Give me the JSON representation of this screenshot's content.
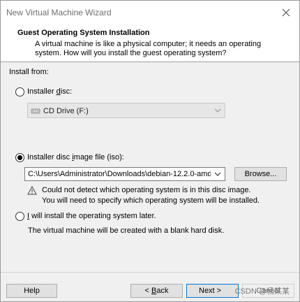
{
  "window": {
    "title": "New Virtual Machine Wizard"
  },
  "header": {
    "title": "Guest Operating System Installation",
    "description": "A virtual machine is like a physical computer; it needs an operating system. How will you install the guest operating system?"
  },
  "install_from": {
    "label": "Install from:",
    "options": [
      {
        "pre": "Installer ",
        "accel": "d",
        "post": "isc:",
        "selected": false
      },
      {
        "pre": "Installer disc ",
        "accel": "i",
        "post": "mage file (iso):",
        "selected": true
      },
      {
        "pre": "",
        "accel": "I",
        "post": " will install the operating system later.",
        "selected": false
      }
    ]
  },
  "drive_select": {
    "value": "CD Drive (F:)",
    "enabled": false
  },
  "iso_select": {
    "value": "C:\\Users\\Administrator\\Downloads\\debian-12.2.0-amd"
  },
  "browse_button": {
    "label": "Browse..."
  },
  "warning": {
    "line1": "Could not detect which operating system is in this disc image.",
    "line2": "You will need to specify which operating system will be installed."
  },
  "later_desc": "The virtual machine will be created with a blank hard disk.",
  "footer": {
    "help": "Help",
    "back_pre": "< ",
    "back_accel": "B",
    "back_post": "ack",
    "next": "Next >",
    "cancel": "Cancel"
  },
  "watermark": "CSDN @杨某某"
}
